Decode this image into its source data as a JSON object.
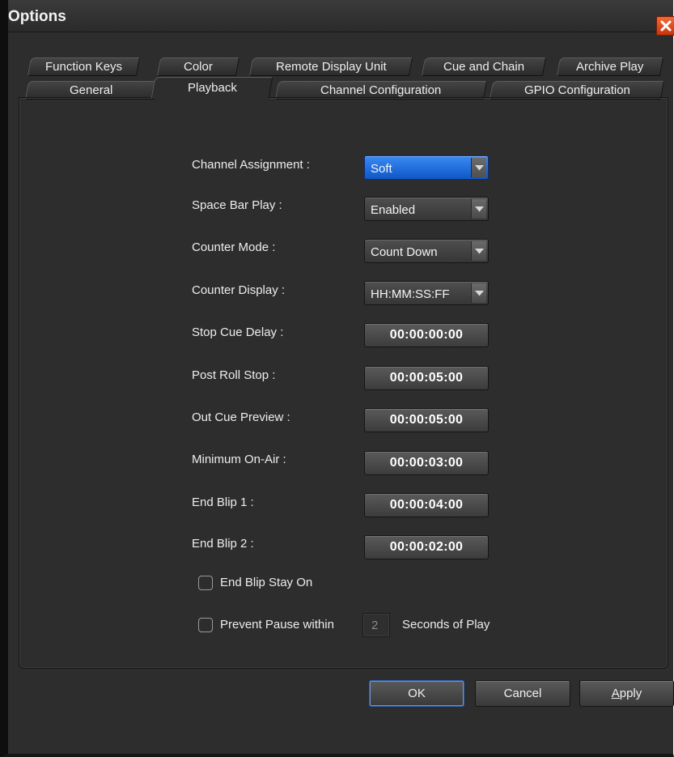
{
  "window": {
    "title": "Options"
  },
  "tabs_row1": [
    {
      "label": "Function Keys"
    },
    {
      "label": "Color"
    },
    {
      "label": "Remote Display Unit"
    },
    {
      "label": "Cue and Chain"
    },
    {
      "label": "Archive Play"
    }
  ],
  "tabs_row2": [
    {
      "label": "General"
    },
    {
      "label": "Playback",
      "selected": true
    },
    {
      "label": "Channel Configuration"
    },
    {
      "label": "GPIO Configuration"
    }
  ],
  "settings": {
    "channel_assignment": {
      "label": "Channel Assignment :",
      "value": "Soft"
    },
    "space_bar_play": {
      "label": "Space Bar Play :",
      "value": "Enabled"
    },
    "counter_mode": {
      "label": "Counter Mode :",
      "value": "Count Down"
    },
    "counter_display": {
      "label": "Counter Display :",
      "value": "HH:MM:SS:FF"
    },
    "stop_cue_delay": {
      "label": "Stop Cue Delay :",
      "value": "00:00:00:00"
    },
    "post_roll_stop": {
      "label": "Post Roll Stop :",
      "value": "00:00:05:00"
    },
    "out_cue_preview": {
      "label": "Out Cue Preview  :",
      "value": "00:00:05:00"
    },
    "minimum_on_air": {
      "label": "Minimum On-Air :",
      "value": "00:00:03:00"
    },
    "end_blip_1": {
      "label": "End Blip 1 :",
      "value": "00:00:04:00"
    },
    "end_blip_2": {
      "label": "End Blip 2 :",
      "value": "00:00:02:00"
    }
  },
  "end_blip_stay_on": {
    "label": "End Blip Stay On",
    "checked": false
  },
  "prevent_pause": {
    "label": "Prevent Pause within",
    "checked": false,
    "value": "2",
    "suffix": "Seconds of Play"
  },
  "buttons": {
    "ok": "OK",
    "cancel": "Cancel",
    "apply_prefix": "A",
    "apply_rest": "pply"
  },
  "colors": {
    "accent": "#1e6ee0",
    "close": "#e0491a",
    "background": "#2d2d2d"
  },
  "icons": {
    "close": "close-icon",
    "dropdown": "chevron-down-icon"
  }
}
